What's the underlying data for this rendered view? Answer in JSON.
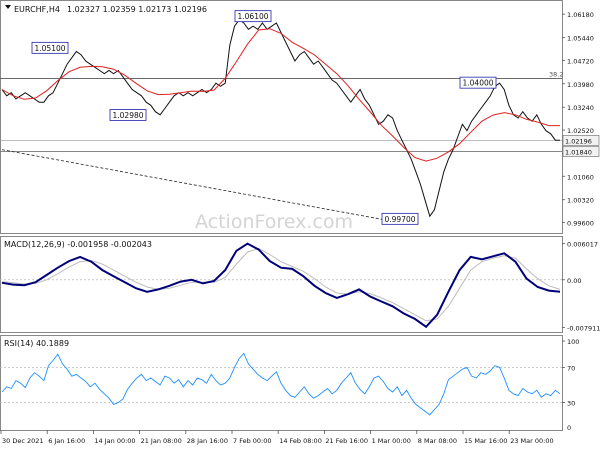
{
  "header": {
    "symbol_info": "EURCHF,H4",
    "ohlc": "1.02327 1.02359 1.02173 1.02196"
  },
  "watermark": "ActionForex.com",
  "colors": {
    "price": "#111111",
    "ma": "#e02020",
    "macd": "#00007a",
    "signal": "#bdbdbd",
    "rsi": "#1e90ff",
    "grid": "#bbbbbb",
    "callout_border": "#2222aa"
  },
  "chart_data": [
    {
      "type": "line",
      "panel": "price",
      "ylim": [
        0.993,
        1.065
      ],
      "y_ticks": [
        "1.06180",
        "1.05440",
        "1.04720",
        "1.03980",
        "1.03240",
        "1.02520",
        "1.01780",
        "1.01060",
        "1.00320",
        "0.99600"
      ],
      "x_ticks": [
        "30 Dec 2021",
        "6 Jan 16:00",
        "14 Jan 00:00",
        "21 Jan 08:00",
        "28 Jan 16:00",
        "7 Feb 00:00",
        "14 Feb 08:00",
        "21 Feb 16:00",
        "1 Mar 00:00",
        "8 Mar 08:00",
        "15 Mar 16:00",
        "23 Mar 00:00"
      ],
      "series": [
        {
          "key": "close",
          "values": [
            1.038,
            1.036,
            1.037,
            1.035,
            1.036,
            1.037,
            1.036,
            1.035,
            1.034,
            1.034,
            1.036,
            1.037,
            1.04,
            1.043,
            1.046,
            1.048,
            1.05,
            1.049,
            1.047,
            1.046,
            1.045,
            1.044,
            1.043,
            1.044,
            1.043,
            1.044,
            1.042,
            1.04,
            1.038,
            1.037,
            1.036,
            1.034,
            1.033,
            1.031,
            1.03,
            1.032,
            1.034,
            1.036,
            1.037,
            1.036,
            1.037,
            1.036,
            1.037,
            1.038,
            1.037,
            1.038,
            1.04,
            1.039,
            1.04,
            1.052,
            1.058,
            1.06,
            1.059,
            1.057,
            1.058,
            1.057,
            1.059,
            1.057,
            1.058,
            1.059,
            1.056,
            1.053,
            1.05,
            1.047,
            1.049,
            1.05,
            1.048,
            1.046,
            1.047,
            1.045,
            1.043,
            1.041,
            1.04,
            1.038,
            1.036,
            1.034,
            1.036,
            1.038,
            1.035,
            1.033,
            1.03,
            1.027,
            1.028,
            1.03,
            1.029,
            1.025,
            1.022,
            1.019,
            1.016,
            1.012,
            1.008,
            1.003,
            0.998,
            1.0,
            1.006,
            1.012,
            1.016,
            1.019,
            1.023,
            1.027,
            1.025,
            1.028,
            1.03,
            1.032,
            1.034,
            1.036,
            1.039,
            1.04,
            1.038,
            1.033,
            1.03,
            1.029,
            1.031,
            1.029,
            1.028,
            1.03,
            1.027,
            1.025,
            1.024,
            1.022,
            1.022
          ]
        },
        {
          "key": "ma",
          "values": [
            1.038,
            1.036,
            1.0349,
            1.0353,
            1.0376,
            1.0408,
            1.0436,
            1.045,
            1.0453,
            1.0452,
            1.0444,
            1.0425,
            1.04,
            1.0376,
            1.0364,
            1.0365,
            1.037,
            1.0375,
            1.0374,
            1.0378,
            1.0415,
            1.0468,
            1.0523,
            1.0568,
            1.0572,
            1.0557,
            1.0529,
            1.051,
            1.0489,
            1.046,
            1.043,
            1.0392,
            1.0349,
            1.0309,
            1.0267,
            1.0233,
            1.0197,
            1.0165,
            1.0154,
            1.0163,
            1.0183,
            1.0209,
            1.0245,
            1.028,
            1.0299,
            1.0307,
            1.03,
            1.0286,
            1.0277,
            1.0266,
            1.0266
          ]
        }
      ],
      "levels": [
        {
          "key": "fib",
          "value": 1.0415,
          "label": "38.2"
        },
        {
          "key": "support",
          "value": 1.0184,
          "label": "1.01840"
        },
        {
          "key": "last",
          "value": 1.02196,
          "label": "1.02196"
        }
      ],
      "callouts": [
        {
          "label": "1.05100",
          "value": 1.051
        },
        {
          "label": "1.02980",
          "value": 1.0298
        },
        {
          "label": "1.06100",
          "value": 1.061
        },
        {
          "label": "1.04000",
          "value": 1.04
        },
        {
          "label": "0.99700",
          "value": 0.997
        }
      ],
      "trendline": [
        1.019,
        0.997
      ]
    },
    {
      "type": "line",
      "panel": "macd",
      "title": "MACD(12,26,9) -0.001958 -0.002043",
      "ylim": [
        -0.0085,
        0.0066
      ],
      "y_ticks": [
        "0.006017",
        "0.00",
        "-0.007911"
      ],
      "zero_label": "0.00",
      "series": [
        {
          "key": "macd",
          "values": [
            -0.0005,
            -0.0008,
            -0.0009,
            -0.0004,
            0.0008,
            0.002,
            0.0031,
            0.0038,
            0.003,
            0.0016,
            0.0006,
            -0.0004,
            -0.0014,
            -0.002,
            -0.0016,
            -0.001,
            -0.0003,
            0.0,
            -0.0006,
            -0.0002,
            0.0016,
            0.0048,
            0.006,
            0.005,
            0.0031,
            0.002,
            0.0018,
            0.0006,
            -0.001,
            -0.0022,
            -0.003,
            -0.0024,
            -0.0016,
            -0.0028,
            -0.0036,
            -0.0044,
            -0.0056,
            -0.0065,
            -0.0078,
            -0.0058,
            -0.002,
            0.0016,
            0.0038,
            0.0034,
            0.0039,
            0.0044,
            0.003,
            0.0002,
            -0.0012,
            -0.0018,
            -0.002
          ]
        },
        {
          "key": "signal",
          "values": [
            -0.0003,
            -0.0005,
            -0.0007,
            -0.0006,
            0.0,
            0.001,
            0.0021,
            0.003,
            0.0032,
            0.0026,
            0.0016,
            0.0006,
            -0.0004,
            -0.0012,
            -0.0016,
            -0.0014,
            -0.0009,
            -0.0004,
            -0.0004,
            -0.0004,
            0.0004,
            0.0026,
            0.0046,
            0.0052,
            0.0042,
            0.003,
            0.0022,
            0.0014,
            0.0002,
            -0.0012,
            -0.0022,
            -0.0024,
            -0.002,
            -0.0023,
            -0.003,
            -0.0038,
            -0.0048,
            -0.0058,
            -0.0068,
            -0.0065,
            -0.0044,
            -0.0014,
            0.0016,
            0.003,
            0.0036,
            0.004,
            0.0036,
            0.0018,
            0.0002,
            -0.001,
            -0.0016
          ]
        }
      ]
    },
    {
      "type": "line",
      "panel": "rsi",
      "title": "RSI(14) 40.1889",
      "ylim": [
        0,
        100
      ],
      "y_ticks": [
        "100",
        "70",
        "30",
        "0"
      ],
      "levels": [
        70,
        30
      ],
      "series": [
        {
          "key": "rsi",
          "values": [
            42,
            48,
            46,
            55,
            52,
            47,
            58,
            64,
            60,
            55,
            72,
            78,
            85,
            74,
            68,
            60,
            62,
            58,
            54,
            48,
            52,
            45,
            40,
            35,
            28,
            30,
            34,
            45,
            52,
            58,
            62,
            55,
            58,
            54,
            50,
            60,
            58,
            52,
            56,
            48,
            55,
            50,
            58,
            56,
            52,
            62,
            55,
            50,
            52,
            58,
            70,
            80,
            86,
            74,
            68,
            62,
            58,
            55,
            60,
            65,
            52,
            44,
            38,
            36,
            42,
            48,
            40,
            35,
            38,
            42,
            46,
            40,
            44,
            52,
            58,
            64,
            52,
            45,
            40,
            48,
            58,
            60,
            54,
            46,
            42,
            48,
            38,
            44,
            35,
            28,
            24,
            20,
            16,
            22,
            28,
            40,
            56,
            60,
            64,
            68,
            70,
            60,
            58,
            64,
            62,
            66,
            72,
            70,
            58,
            44,
            40,
            38,
            46,
            42,
            40,
            44,
            36,
            40,
            38,
            44,
            40
          ]
        }
      ]
    }
  ]
}
